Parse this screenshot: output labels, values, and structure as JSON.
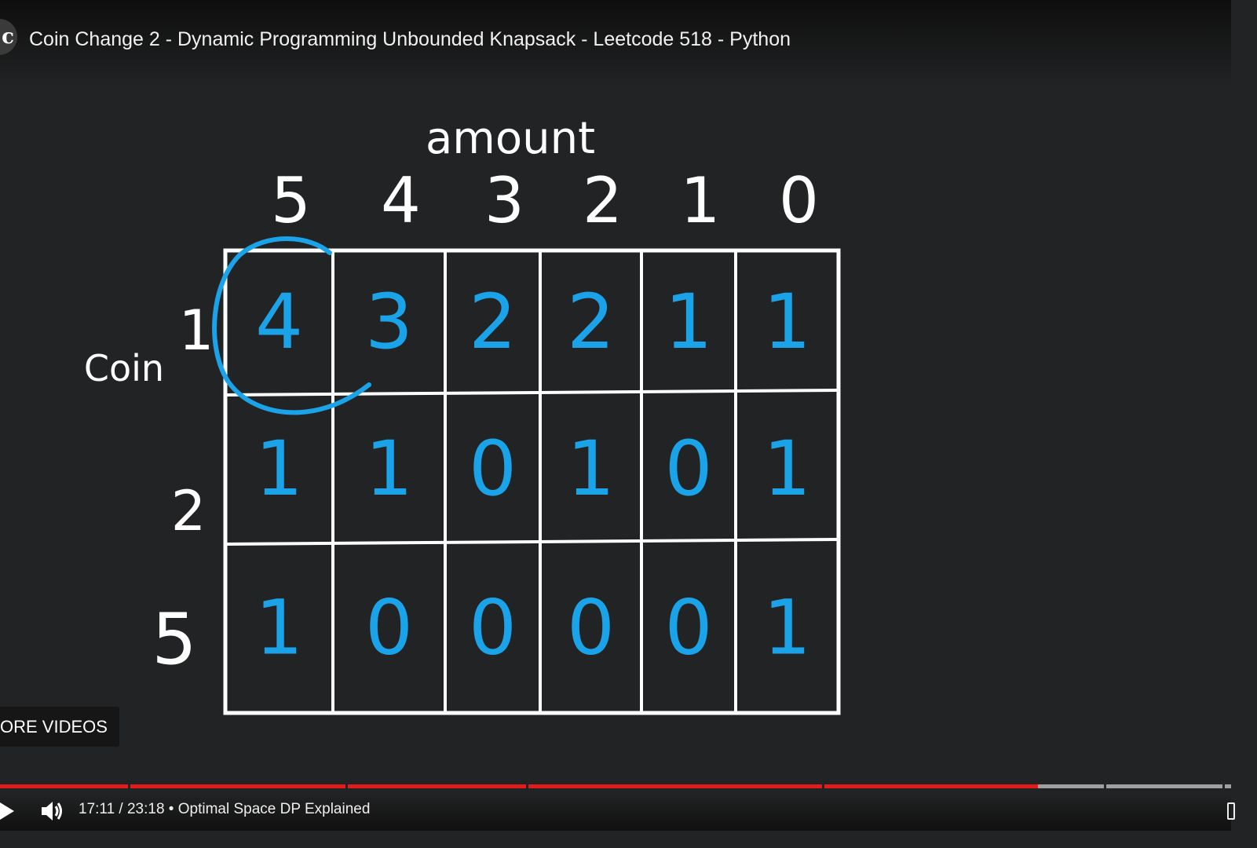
{
  "video": {
    "title": "Coin Change 2 - Dynamic Programming Unbounded Knapsack - Leetcode 518 - Python",
    "channel_avatar_glyph": "c"
  },
  "board": {
    "amount_label": "amount",
    "coin_label": "Coin",
    "amount_headers": [
      "5",
      "4",
      "3",
      "2",
      "1",
      "0"
    ],
    "coin_headers": [
      "1",
      "2",
      "5"
    ],
    "cells": [
      [
        "4",
        "3",
        "2",
        "2",
        "1",
        "1"
      ],
      [
        "1",
        "1",
        "0",
        "1",
        "0",
        "1"
      ],
      [
        "1",
        "0",
        "0",
        "0",
        "0",
        "1"
      ]
    ],
    "circled_cell": {
      "row": 0,
      "col": 0
    },
    "colors": {
      "chalk": "#ffffff",
      "ink": "#1aa3e8",
      "background": "#222324"
    }
  },
  "more_videos_label": "ORE VIDEOS",
  "player": {
    "time": "17:11 / 23:18 • Optimal Space DP Explained",
    "progress_fraction": 0.843,
    "colors": {
      "played": "#e31b1b",
      "unplayed": "#a0a0a0"
    },
    "icons": [
      "play-icon",
      "volume-icon",
      "miniplayer-icon"
    ]
  }
}
